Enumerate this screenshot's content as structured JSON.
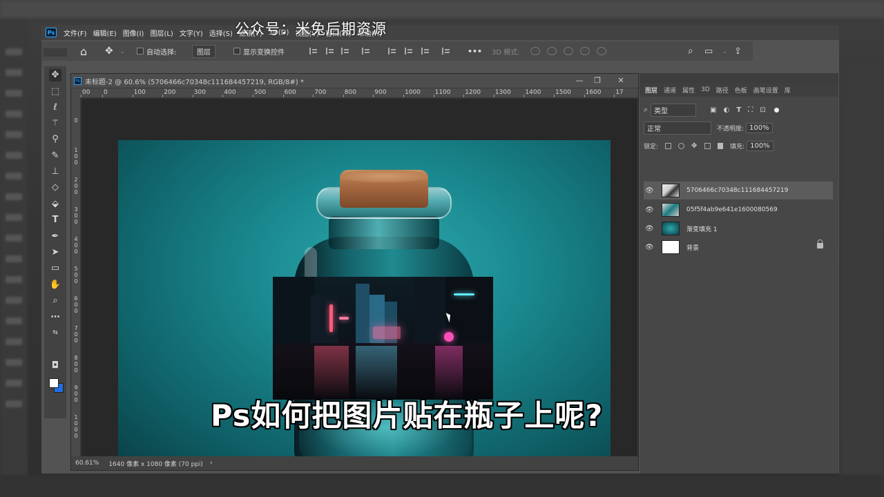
{
  "watermark": "公众号：米兔后期资源",
  "menubar": {
    "items": [
      "文件(F)",
      "编辑(E)",
      "图像(I)",
      "图层(L)",
      "文字(Y)",
      "选择(S)",
      "滤镜(T)",
      "3D(D)",
      "视图(V)",
      "窗口(W)",
      "帮助(H)"
    ]
  },
  "options": {
    "auto_select_label": "自动选择:",
    "auto_select_value": "图层",
    "show_transform_label": "显示变换控件",
    "three_d_mode_label": "3D 模式:",
    "more": "•••"
  },
  "document": {
    "title": "未标题-2 @ 60.6% (5706466c70348c111684457219, RGB/8#) *",
    "minimize": "—",
    "restore": "❐",
    "close": "✕",
    "ruler_h": [
      "00",
      "0",
      "100",
      "200",
      "300",
      "400",
      "500",
      "600",
      "700",
      "800",
      "900",
      "1000",
      "1100",
      "1200",
      "1300",
      "1400",
      "1500",
      "1600",
      "17"
    ],
    "ruler_v": [
      "0",
      "1\n0\n0",
      "2\n0\n0",
      "3\n0\n0",
      "4\n0\n0",
      "5\n0\n0",
      "6\n0\n0",
      "7\n0\n0",
      "8\n0\n0",
      "9\n0\n0",
      "1\n0\n0\n0"
    ],
    "status_zoom": "60.61%",
    "status_info": "1640 像素 x 1080 像素 (70 ppi)",
    "status_arrow": "›"
  },
  "panel": {
    "tabs": [
      "图层",
      "通道",
      "属性",
      "3D",
      "路径",
      "色板",
      "画笔设置",
      "库"
    ],
    "filter_label": "类型",
    "blend_mode": "正常",
    "opacity_label": "不透明度:",
    "opacity_value": "100%",
    "lock_label": "锁定:",
    "fill_label": "填充:",
    "fill_value": "100%",
    "layers": [
      {
        "name": "5706466c70348c111684457219",
        "visible": true,
        "selected": true
      },
      {
        "name": "05f5f4ab9e641e1600080569",
        "visible": true,
        "selected": false
      },
      {
        "name": "渐变填充 1",
        "visible": true,
        "selected": false
      },
      {
        "name": "背景",
        "visible": true,
        "selected": false,
        "locked": true
      }
    ]
  },
  "subtitle": "Ps如何把图片贴在瓶子上呢?",
  "colors": {
    "foreground": "#ffffff",
    "background": "#1f6fe0",
    "canvas_teal": "#1a8a90"
  }
}
